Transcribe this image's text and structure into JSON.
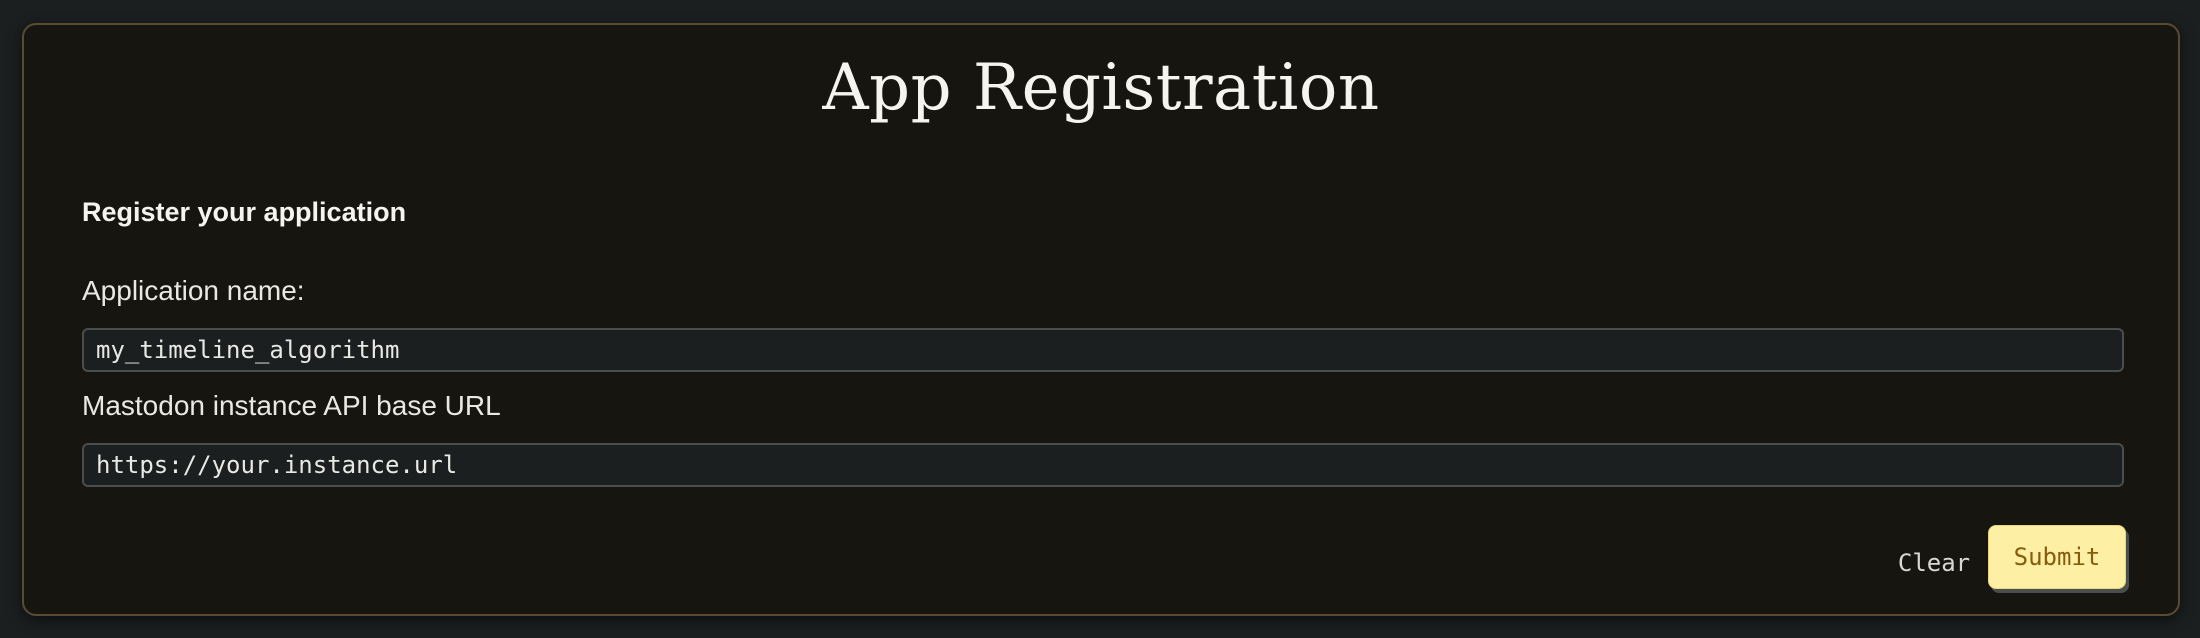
{
  "page": {
    "title": "App Registration"
  },
  "form": {
    "heading": "Register your application",
    "fields": [
      {
        "label": "Application name:",
        "value": "my_timeline_algorithm"
      },
      {
        "label": "Mastodon instance API base URL",
        "placeholder": "https://your.instance.url",
        "value": ""
      }
    ],
    "clear_label": "Clear",
    "submit_label": "Submit"
  },
  "colors": {
    "page_background": "#1b1f1f",
    "card_background": "#171510",
    "card_border": "#5a4a30",
    "submit_background": "#fdf0a4",
    "submit_text": "#8a5a0c"
  }
}
